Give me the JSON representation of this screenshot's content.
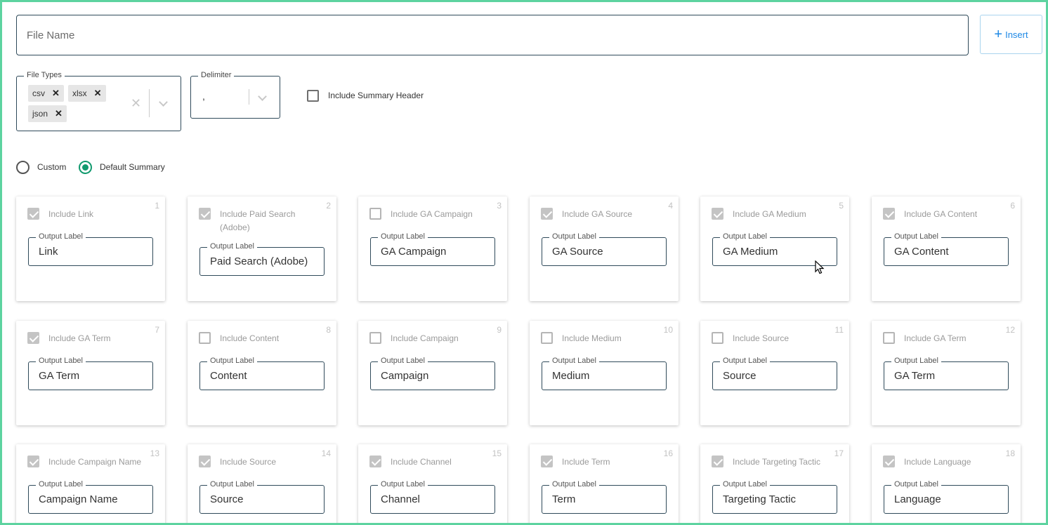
{
  "file_name": {
    "placeholder": "File Name",
    "value": ""
  },
  "insert_button": {
    "label": "Insert",
    "icon": "plus-icon",
    "color": "#1e88e5"
  },
  "file_types": {
    "legend": "File Types",
    "chips": [
      "csv",
      "xlsx",
      "json"
    ]
  },
  "delimiter": {
    "legend": "Delimiter",
    "value": ","
  },
  "summary_header": {
    "label": "Include Summary Header",
    "checked": false
  },
  "summary_mode": {
    "options": [
      "Custom",
      "Default Summary"
    ],
    "selected": "Default Summary",
    "accent": "#119a6e"
  },
  "output_label_legend": "Output Label",
  "cards": [
    {
      "num": "1",
      "label": "Include Link",
      "checked": true,
      "output": "Link"
    },
    {
      "num": "2",
      "label": "Include Paid Search (Adobe)",
      "checked": true,
      "output": "Paid Search (Adobe)"
    },
    {
      "num": "3",
      "label": "Include GA Campaign",
      "checked": false,
      "output": "GA Campaign"
    },
    {
      "num": "4",
      "label": "Include GA Source",
      "checked": true,
      "output": "GA Source"
    },
    {
      "num": "5",
      "label": "Include GA Medium",
      "checked": true,
      "output": "GA Medium"
    },
    {
      "num": "6",
      "label": "Include GA Content",
      "checked": true,
      "output": "GA Content"
    },
    {
      "num": "7",
      "label": "Include GA Term",
      "checked": true,
      "output": "GA Term"
    },
    {
      "num": "8",
      "label": "Include Content",
      "checked": false,
      "output": "Content"
    },
    {
      "num": "9",
      "label": "Include Campaign",
      "checked": false,
      "output": "Campaign"
    },
    {
      "num": "10",
      "label": "Include Medium",
      "checked": false,
      "output": "Medium"
    },
    {
      "num": "11",
      "label": "Include Source",
      "checked": false,
      "output": "Source"
    },
    {
      "num": "12",
      "label": "Include GA Term",
      "checked": false,
      "output": "GA Term"
    },
    {
      "num": "13",
      "label": "Include Campaign Name",
      "checked": true,
      "output": "Campaign Name"
    },
    {
      "num": "14",
      "label": "Include Source",
      "checked": true,
      "output": "Source"
    },
    {
      "num": "15",
      "label": "Include Channel",
      "checked": true,
      "output": "Channel"
    },
    {
      "num": "16",
      "label": "Include Term",
      "checked": true,
      "output": "Term"
    },
    {
      "num": "17",
      "label": "Include Targeting Tactic",
      "checked": true,
      "output": "Targeting Tactic"
    },
    {
      "num": "18",
      "label": "Include Language",
      "checked": true,
      "output": "Language"
    }
  ]
}
